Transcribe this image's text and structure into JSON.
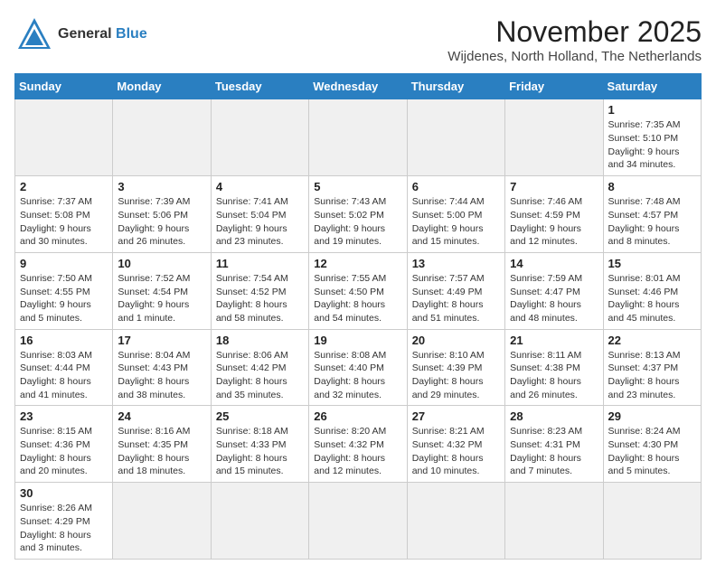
{
  "header": {
    "logo_line1": "General",
    "logo_line2": "Blue",
    "month_year": "November 2025",
    "location": "Wijdenes, North Holland, The Netherlands"
  },
  "weekdays": [
    "Sunday",
    "Monday",
    "Tuesday",
    "Wednesday",
    "Thursday",
    "Friday",
    "Saturday"
  ],
  "weeks": [
    [
      {
        "day": "",
        "info": "",
        "empty": true
      },
      {
        "day": "",
        "info": "",
        "empty": true
      },
      {
        "day": "",
        "info": "",
        "empty": true
      },
      {
        "day": "",
        "info": "",
        "empty": true
      },
      {
        "day": "",
        "info": "",
        "empty": true
      },
      {
        "day": "",
        "info": "",
        "empty": true
      },
      {
        "day": "1",
        "info": "Sunrise: 7:35 AM\nSunset: 5:10 PM\nDaylight: 9 hours\nand 34 minutes."
      }
    ],
    [
      {
        "day": "2",
        "info": "Sunrise: 7:37 AM\nSunset: 5:08 PM\nDaylight: 9 hours\nand 30 minutes."
      },
      {
        "day": "3",
        "info": "Sunrise: 7:39 AM\nSunset: 5:06 PM\nDaylight: 9 hours\nand 26 minutes."
      },
      {
        "day": "4",
        "info": "Sunrise: 7:41 AM\nSunset: 5:04 PM\nDaylight: 9 hours\nand 23 minutes."
      },
      {
        "day": "5",
        "info": "Sunrise: 7:43 AM\nSunset: 5:02 PM\nDaylight: 9 hours\nand 19 minutes."
      },
      {
        "day": "6",
        "info": "Sunrise: 7:44 AM\nSunset: 5:00 PM\nDaylight: 9 hours\nand 15 minutes."
      },
      {
        "day": "7",
        "info": "Sunrise: 7:46 AM\nSunset: 4:59 PM\nDaylight: 9 hours\nand 12 minutes."
      },
      {
        "day": "8",
        "info": "Sunrise: 7:48 AM\nSunset: 4:57 PM\nDaylight: 9 hours\nand 8 minutes."
      }
    ],
    [
      {
        "day": "9",
        "info": "Sunrise: 7:50 AM\nSunset: 4:55 PM\nDaylight: 9 hours\nand 5 minutes."
      },
      {
        "day": "10",
        "info": "Sunrise: 7:52 AM\nSunset: 4:54 PM\nDaylight: 9 hours\nand 1 minute."
      },
      {
        "day": "11",
        "info": "Sunrise: 7:54 AM\nSunset: 4:52 PM\nDaylight: 8 hours\nand 58 minutes."
      },
      {
        "day": "12",
        "info": "Sunrise: 7:55 AM\nSunset: 4:50 PM\nDaylight: 8 hours\nand 54 minutes."
      },
      {
        "day": "13",
        "info": "Sunrise: 7:57 AM\nSunset: 4:49 PM\nDaylight: 8 hours\nand 51 minutes."
      },
      {
        "day": "14",
        "info": "Sunrise: 7:59 AM\nSunset: 4:47 PM\nDaylight: 8 hours\nand 48 minutes."
      },
      {
        "day": "15",
        "info": "Sunrise: 8:01 AM\nSunset: 4:46 PM\nDaylight: 8 hours\nand 45 minutes."
      }
    ],
    [
      {
        "day": "16",
        "info": "Sunrise: 8:03 AM\nSunset: 4:44 PM\nDaylight: 8 hours\nand 41 minutes."
      },
      {
        "day": "17",
        "info": "Sunrise: 8:04 AM\nSunset: 4:43 PM\nDaylight: 8 hours\nand 38 minutes."
      },
      {
        "day": "18",
        "info": "Sunrise: 8:06 AM\nSunset: 4:42 PM\nDaylight: 8 hours\nand 35 minutes."
      },
      {
        "day": "19",
        "info": "Sunrise: 8:08 AM\nSunset: 4:40 PM\nDaylight: 8 hours\nand 32 minutes."
      },
      {
        "day": "20",
        "info": "Sunrise: 8:10 AM\nSunset: 4:39 PM\nDaylight: 8 hours\nand 29 minutes."
      },
      {
        "day": "21",
        "info": "Sunrise: 8:11 AM\nSunset: 4:38 PM\nDaylight: 8 hours\nand 26 minutes."
      },
      {
        "day": "22",
        "info": "Sunrise: 8:13 AM\nSunset: 4:37 PM\nDaylight: 8 hours\nand 23 minutes."
      }
    ],
    [
      {
        "day": "23",
        "info": "Sunrise: 8:15 AM\nSunset: 4:36 PM\nDaylight: 8 hours\nand 20 minutes."
      },
      {
        "day": "24",
        "info": "Sunrise: 8:16 AM\nSunset: 4:35 PM\nDaylight: 8 hours\nand 18 minutes."
      },
      {
        "day": "25",
        "info": "Sunrise: 8:18 AM\nSunset: 4:33 PM\nDaylight: 8 hours\nand 15 minutes."
      },
      {
        "day": "26",
        "info": "Sunrise: 8:20 AM\nSunset: 4:32 PM\nDaylight: 8 hours\nand 12 minutes."
      },
      {
        "day": "27",
        "info": "Sunrise: 8:21 AM\nSunset: 4:32 PM\nDaylight: 8 hours\nand 10 minutes."
      },
      {
        "day": "28",
        "info": "Sunrise: 8:23 AM\nSunset: 4:31 PM\nDaylight: 8 hours\nand 7 minutes."
      },
      {
        "day": "29",
        "info": "Sunrise: 8:24 AM\nSunset: 4:30 PM\nDaylight: 8 hours\nand 5 minutes."
      }
    ],
    [
      {
        "day": "30",
        "info": "Sunrise: 8:26 AM\nSunset: 4:29 PM\nDaylight: 8 hours\nand 3 minutes."
      },
      {
        "day": "",
        "info": "",
        "empty": true
      },
      {
        "day": "",
        "info": "",
        "empty": true
      },
      {
        "day": "",
        "info": "",
        "empty": true
      },
      {
        "day": "",
        "info": "",
        "empty": true
      },
      {
        "day": "",
        "info": "",
        "empty": true
      },
      {
        "day": "",
        "info": "",
        "empty": true
      }
    ]
  ]
}
